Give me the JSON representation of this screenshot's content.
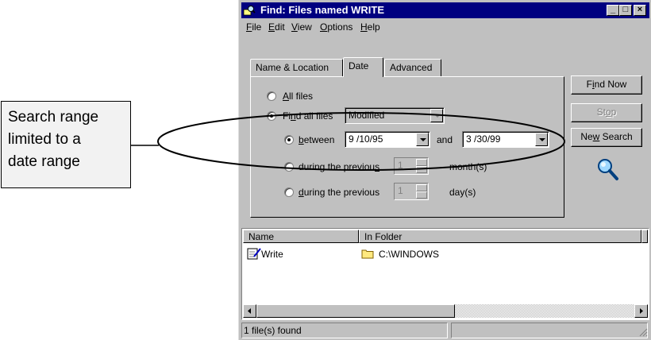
{
  "callout": {
    "lines": [
      "Search range",
      "limited to a",
      "date range"
    ]
  },
  "window": {
    "title": "Find: Files named WRITE",
    "controls": {
      "minimize": "_",
      "maximize": "□",
      "close": "×"
    }
  },
  "menu": {
    "items": [
      {
        "accel": "F",
        "rest": "ile"
      },
      {
        "accel": "E",
        "rest": "dit"
      },
      {
        "accel": "V",
        "rest": "iew"
      },
      {
        "accel": "O",
        "rest": "ptions"
      },
      {
        "accel": "H",
        "rest": "elp"
      }
    ]
  },
  "tabs": [
    {
      "label": "Name & Location",
      "active": false
    },
    {
      "label": "Date",
      "active": true
    },
    {
      "label": "Advanced",
      "active": false
    }
  ],
  "date_panel": {
    "all_files": {
      "accel": "A",
      "rest": "ll files",
      "selected": false
    },
    "find_all_files": {
      "pre": "Fi",
      "accel": "n",
      "rest": "d all files",
      "selected": true
    },
    "date_type": "Modified",
    "between": {
      "accel": "b",
      "rest": "etween",
      "selected": true,
      "from": "9 /10/95",
      "and_label": "and",
      "to": "3 /30/99"
    },
    "months": {
      "pre": "during the previou",
      "accel": "s",
      "value": "1",
      "unit": "month(s)",
      "selected": false
    },
    "days": {
      "accel": "d",
      "rest": "uring the previous",
      "value": "1",
      "unit": "day(s)",
      "selected": false
    }
  },
  "buttons": {
    "find_now": {
      "pre": "F",
      "accel": "i",
      "rest": "nd Now"
    },
    "stop": {
      "pre": "St",
      "accel": "o",
      "rest": "p"
    },
    "new_search": {
      "pre": "Ne",
      "accel": "w",
      "rest": " Search"
    }
  },
  "results": {
    "columns": [
      "Name",
      "In Folder"
    ],
    "rows": [
      {
        "name": "Write",
        "folder": "C:\\WINDOWS"
      }
    ]
  },
  "status": {
    "text": "1 file(s) found"
  }
}
